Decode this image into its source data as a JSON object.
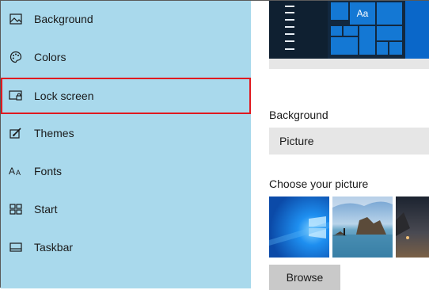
{
  "sidebar": {
    "items": [
      {
        "label": "Background",
        "icon": "picture-icon"
      },
      {
        "label": "Colors",
        "icon": "palette-icon"
      },
      {
        "label": "Lock screen",
        "icon": "lock-screen-icon",
        "selected": true
      },
      {
        "label": "Themes",
        "icon": "brush-icon"
      },
      {
        "label": "Fonts",
        "icon": "font-icon"
      },
      {
        "label": "Start",
        "icon": "start-tiles-icon"
      },
      {
        "label": "Taskbar",
        "icon": "taskbar-icon"
      }
    ]
  },
  "preview": {
    "tile_text": "Aa"
  },
  "background_section": {
    "title": "Background",
    "dropdown_value": "Picture"
  },
  "picture_section": {
    "title": "Choose your picture",
    "browse_label": "Browse"
  },
  "colors": {
    "sidebar_bg": "#a9d9ec",
    "selection_outline": "#e0191f",
    "accent": "#0a67c9"
  }
}
